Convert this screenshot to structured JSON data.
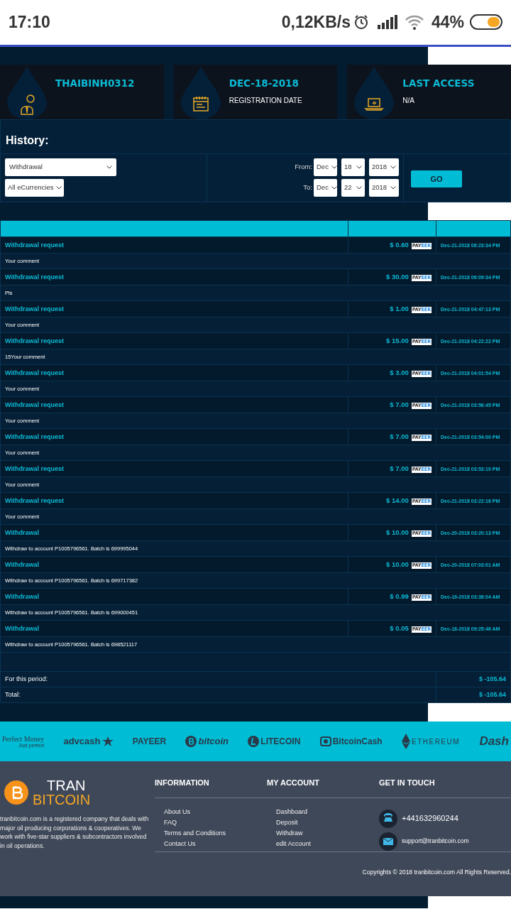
{
  "status_bar": {
    "time": "17:10",
    "network_speed": "0,12KB/s",
    "battery": "44%",
    "level": 0.44
  },
  "info_cards": [
    {
      "kind": "user",
      "title": "THAIBINH0312"
    },
    {
      "kind": "calendar",
      "title": "DEC-18-2018",
      "subtitle": "REGISTRATION DATE"
    },
    {
      "kind": "laptop",
      "title": "LAST ACCESS",
      "subtitle": "N/A"
    }
  ],
  "history": {
    "title": "History:",
    "type_select": "Withdrawal",
    "currency_select": "All eCurrencies",
    "ranges": [
      {
        "label": "From:",
        "month": "Dec",
        "day": "18",
        "year": "2018"
      },
      {
        "label": "To:",
        "month": "Dec",
        "day": "22",
        "year": "2018"
      }
    ],
    "go_button": "GO"
  },
  "transactions": [
    {
      "type": "Withdrawal request",
      "amount": "$ 0.60",
      "method": "PAYEER",
      "date": "Dec-21-2018 06:23:34 PM",
      "comment": "Your comment"
    },
    {
      "type": "Withdrawal request",
      "amount": "$ 30.00",
      "method": "PAYEER",
      "date": "Dec-21-2018 06:09:34 PM",
      "comment": "Pls"
    },
    {
      "type": "Withdrawal request",
      "amount": "$ 1.00",
      "method": "PAYEER",
      "date": "Dec-21-2018 04:47:13 PM",
      "comment": "Your comment"
    },
    {
      "type": "Withdrawal request",
      "amount": "$ 15.00",
      "method": "PAYEER",
      "date": "Dec-21-2018 04:22:22 PM",
      "comment": "15Your comment"
    },
    {
      "type": "Withdrawal request",
      "amount": "$ 3.00",
      "method": "PAYEER",
      "date": "Dec-21-2018 04:01:54 PM",
      "comment": "Your comment"
    },
    {
      "type": "Withdrawal request",
      "amount": "$ 7.00",
      "method": "PAYEER",
      "date": "Dec-21-2018 03:56:45 PM",
      "comment": "Your comment"
    },
    {
      "type": "Withdrawal request",
      "amount": "$ 7.00",
      "method": "PAYEER",
      "date": "Dec-21-2018 03:54:00 PM",
      "comment": "Your comment"
    },
    {
      "type": "Withdrawal request",
      "amount": "$ 7.00",
      "method": "PAYEER",
      "date": "Dec-21-2018 03:53:10 PM",
      "comment": "Your comment"
    },
    {
      "type": "Withdrawal request",
      "amount": "$ 14.00",
      "method": "PAYEER",
      "date": "Dec-21-2018 03:22:16 PM",
      "comment": "Your comment"
    },
    {
      "type": "Withdrawal",
      "amount": "$ 10.00",
      "method": "PAYEER",
      "date": "Dec-20-2018 03:20:13 PM",
      "comment": "Withdraw to account P1005796561. Batch is 699995044"
    },
    {
      "type": "Withdrawal",
      "amount": "$ 10.00",
      "method": "PAYEER",
      "date": "Dec-20-2018 07:03:01 AM",
      "comment": "Withdraw to account P1005796561. Batch is 699717382"
    },
    {
      "type": "Withdrawal",
      "amount": "$ 0.99",
      "method": "PAYEER",
      "date": "Dec-19-2018 03:38:04 AM",
      "comment": "Withdraw to account P1005796561. Batch is 699000451"
    },
    {
      "type": "Withdrawal",
      "amount": "$ 0.05",
      "method": "PAYEER",
      "date": "Dec-18-2018 09:25:46 AM",
      "comment": "Withdraw to account P1005796561. Batch is 698521117"
    }
  ],
  "totals": [
    {
      "label": "For this period:",
      "value": "$ -105.64"
    },
    {
      "label": "Total:",
      "value": "$ -105.64"
    }
  ],
  "payment_logos": [
    {
      "kind": "perfectmoney",
      "name": "Perfect Money",
      "tagline": "Just perfect"
    },
    {
      "kind": "advcash",
      "name": "advcash"
    },
    {
      "kind": "payeer",
      "name": "PAYEER"
    },
    {
      "kind": "bitcoin",
      "name": "bitcoin"
    },
    {
      "kind": "litecoin",
      "name": "LITECOIN"
    },
    {
      "kind": "bitcoincash",
      "name": "BitcoinCash"
    },
    {
      "kind": "ethereum",
      "name": "ETHEREUM"
    },
    {
      "kind": "dash",
      "name": "Dash"
    }
  ],
  "footer": {
    "logo_top": "TRAN",
    "logo_bottom": "BITCOIN",
    "about": "tranbitcoin.com is a registered company that deals with major oil producing corporations & cooperatives. We work with five-star suppliers & subcontractors involved in oil operations.",
    "columns": [
      {
        "title": "INFORMATION",
        "links": [
          "About Us",
          "FAQ",
          "Terms and Conditions",
          "Contact Us"
        ]
      },
      {
        "title": "MY ACCOUNT",
        "links": [
          "Dashboard",
          "Deposit",
          "Withdraw",
          "edit Account"
        ]
      }
    ],
    "contact": {
      "title": "GET IN TOUCH",
      "items": [
        {
          "kind": "phone",
          "text": "+441632960244"
        },
        {
          "kind": "email",
          "text": "support@tranbitcoin.com"
        }
      ]
    },
    "copyright": "Copyrights © 2018 tranbitcoin.com All Rights Reserved."
  }
}
